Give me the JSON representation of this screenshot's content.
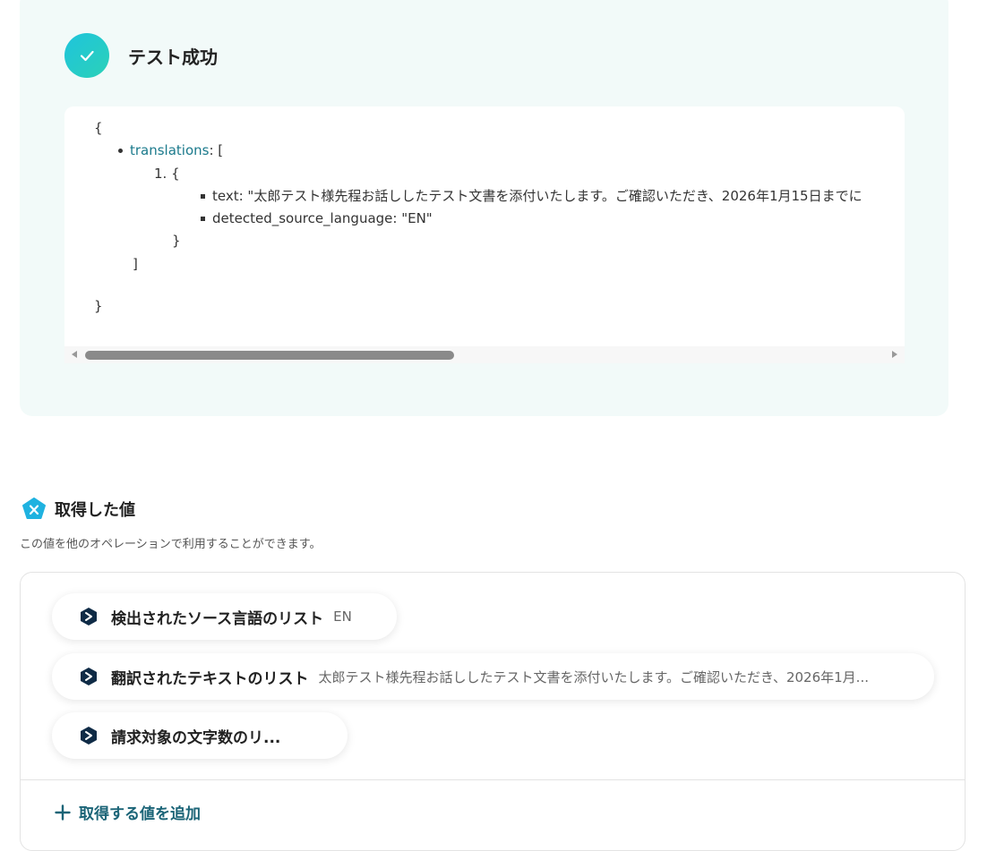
{
  "test_result": {
    "title": "テスト成功",
    "json": {
      "open_brace": "{",
      "translations_key": "translations",
      "translations_sep": ": [",
      "item_index": "1. {",
      "text_line": "text: \"太郎テスト様先程お話ししたテスト文書を添付いたします。ご確認いただき、2026年1月15日までに",
      "detected_line": "detected_source_language: \"EN\"",
      "item_close": "}",
      "array_close": "]",
      "close_brace": "}"
    }
  },
  "values": {
    "title": "取得した値",
    "description": "この値を他のオペレーションで利用することができます。",
    "items": [
      {
        "label": "検出されたソース言語のリスト",
        "value": "EN"
      },
      {
        "label": "翻訳されたテキストのリスト",
        "value": "太郎テスト様先程お話ししたテスト文書を添付いたします。ご確認いただき、2026年1月..."
      },
      {
        "label": "請求対象の文字数のリ...",
        "value": ""
      }
    ],
    "add_label": "取得する値を追加"
  },
  "colors": {
    "panel_bg": "#f2faf9",
    "accent": "#1fc4dc",
    "key_blue": "#1b7a8c",
    "add_text": "#1b6477"
  }
}
